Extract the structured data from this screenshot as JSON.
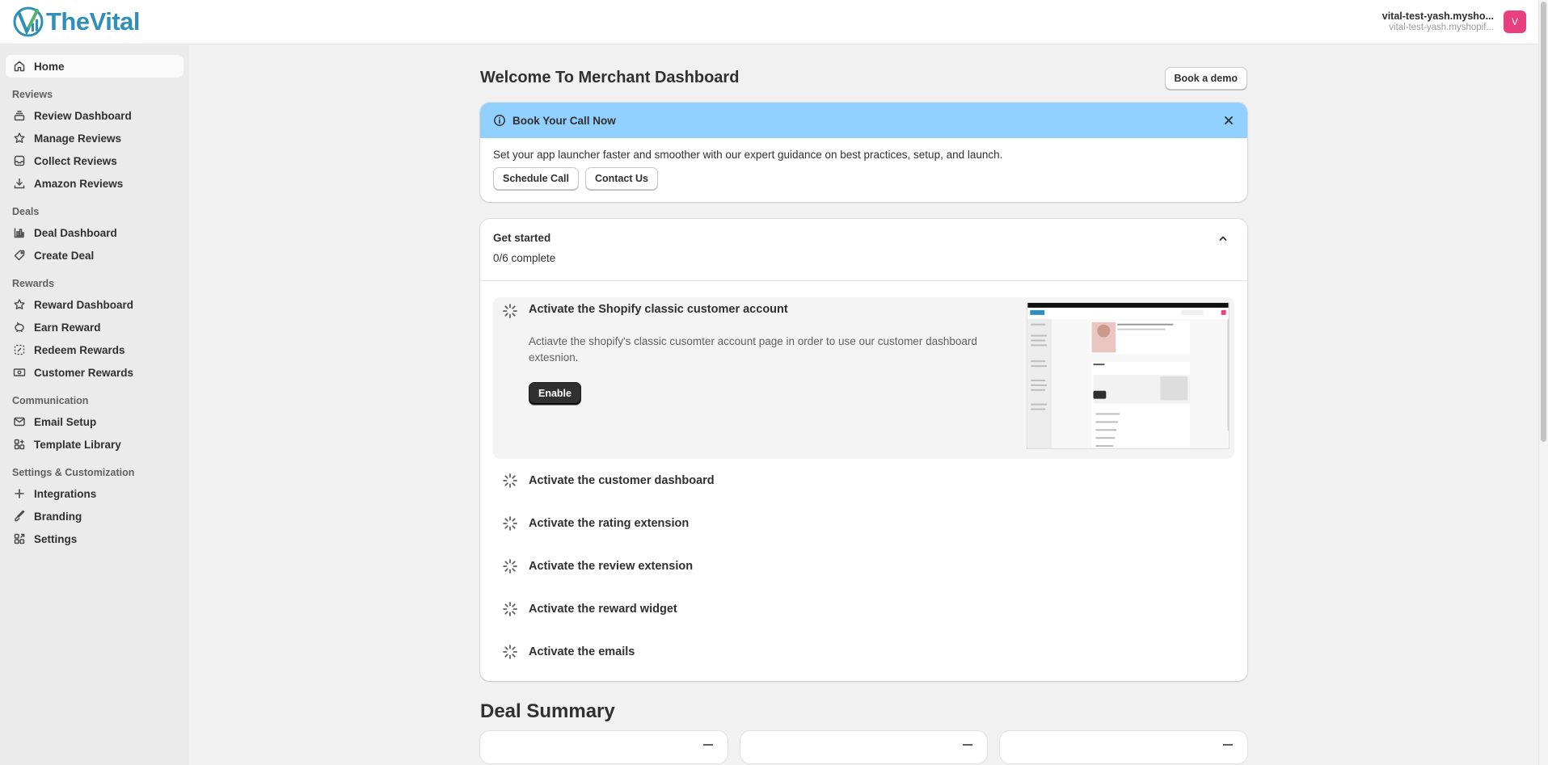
{
  "app": {
    "name": "TheVital"
  },
  "store": {
    "name": "vital-test-yash.mysho...",
    "domain": "vital-test-yash.myshopif...",
    "avatar_letter": "V"
  },
  "sidebar": {
    "home": "Home",
    "sections": {
      "reviews": "Reviews",
      "deals": "Deals",
      "rewards": "Rewards",
      "communication": "Communication",
      "settings": "Settings & Customization"
    },
    "items": {
      "review_dashboard": "Review Dashboard",
      "manage_reviews": "Manage Reviews",
      "collect_reviews": "Collect Reviews",
      "amazon_reviews": "Amazon Reviews",
      "deal_dashboard": "Deal Dashboard",
      "create_deal": "Create Deal",
      "reward_dashboard": "Reward Dashboard",
      "earn_reward": "Earn Reward",
      "redeem_rewards": "Redeem Rewards",
      "customer_rewards": "Customer Rewards",
      "email_setup": "Email Setup",
      "template_library": "Template Library",
      "integrations": "Integrations",
      "branding": "Branding",
      "settings": "Settings"
    }
  },
  "page": {
    "title": "Welcome To Merchant Dashboard",
    "book_demo": "Book a demo"
  },
  "banner": {
    "title": "Book Your Call Now",
    "text": "Set your app launcher faster and smoother with our expert guidance on best practices, setup, and launch.",
    "schedule": "Schedule Call",
    "contact": "Contact Us"
  },
  "get_started": {
    "title": "Get started",
    "progress": "0/6 complete",
    "tasks": [
      {
        "title": "Activate the Shopify classic customer account",
        "description": "Actiavte the shopify's classic cusomter account page in order to use our customer dashboard extesnion.",
        "button": "Enable"
      },
      {
        "title": "Activate the customer dashboard"
      },
      {
        "title": "Activate the rating extension"
      },
      {
        "title": "Activate the review extension"
      },
      {
        "title": "Activate the reward widget"
      },
      {
        "title": "Activate the emails"
      }
    ]
  },
  "deal_summary": {
    "title": "Deal Summary"
  },
  "colors": {
    "brand": "#2f8fb8",
    "banner": "#91d0ff",
    "avatar": "#e8407f",
    "primary_button": "#303030"
  }
}
